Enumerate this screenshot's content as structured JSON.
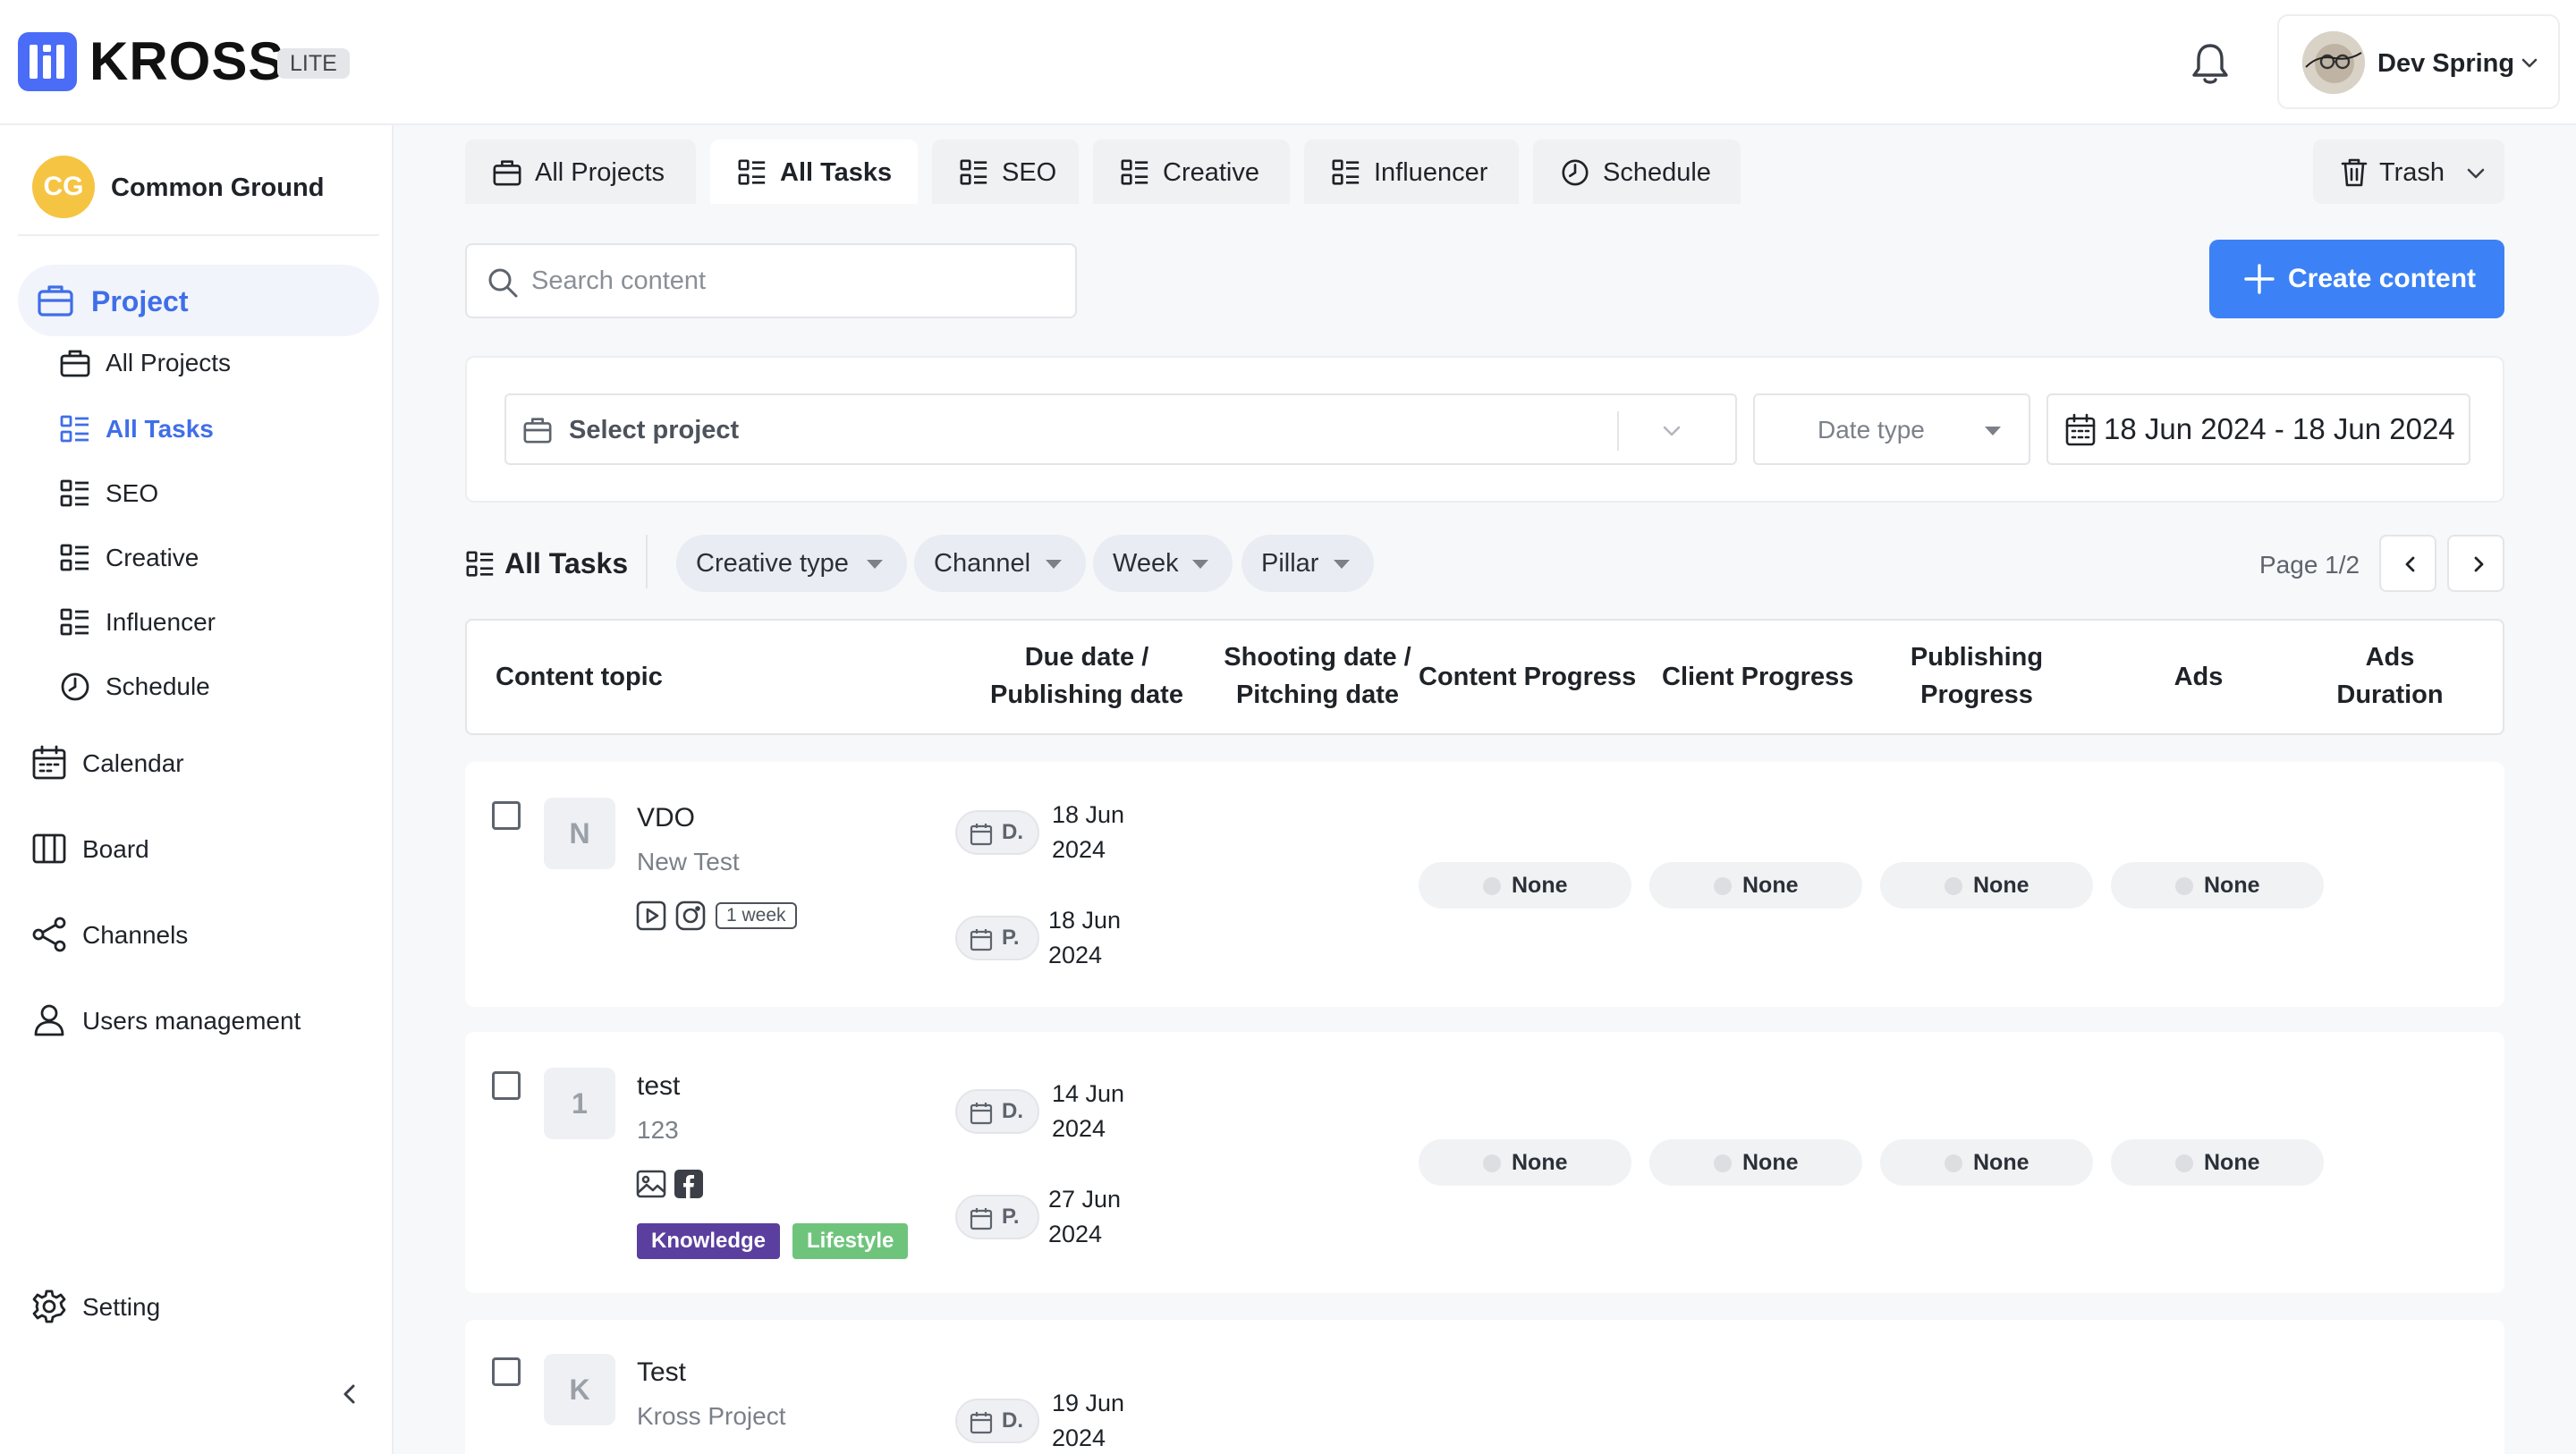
{
  "app": {
    "logo_text": "KROSS",
    "logo_badge": "LITE"
  },
  "header": {
    "user_name": "Dev Spring"
  },
  "sidebar": {
    "workspace_initials": "CG",
    "workspace_name": "Common Ground",
    "project_label": "Project",
    "project_items": [
      {
        "label": "All Projects",
        "icon": "briefcase-icon"
      },
      {
        "label": "All Tasks",
        "icon": "task-list-icon",
        "active": true
      },
      {
        "label": "SEO",
        "icon": "task-list-icon"
      },
      {
        "label": "Creative",
        "icon": "task-list-icon"
      },
      {
        "label": "Influencer",
        "icon": "task-list-icon"
      },
      {
        "label": "Schedule",
        "icon": "clock-icon"
      }
    ],
    "nav_items": [
      {
        "label": "Calendar",
        "icon": "calendar-icon"
      },
      {
        "label": "Board",
        "icon": "board-icon"
      },
      {
        "label": "Channels",
        "icon": "share-icon"
      },
      {
        "label": "Users management",
        "icon": "user-icon"
      }
    ],
    "setting_label": "Setting"
  },
  "tabs": [
    {
      "label": "All Projects",
      "icon": "briefcase-icon"
    },
    {
      "label": "All Tasks",
      "icon": "task-list-icon",
      "active": true
    },
    {
      "label": "SEO",
      "icon": "task-list-icon"
    },
    {
      "label": "Creative",
      "icon": "task-list-icon"
    },
    {
      "label": "Influencer",
      "icon": "task-list-icon"
    },
    {
      "label": "Schedule",
      "icon": "clock-icon"
    }
  ],
  "trash_label": "Trash",
  "search": {
    "placeholder": "Search content",
    "value": ""
  },
  "create_label": "Create content",
  "filters": {
    "select_project_placeholder": "Select project",
    "date_type_placeholder": "Date type",
    "date_range": "18 Jun 2024 - 18 Jun 2024"
  },
  "toolbar": {
    "title": "All Tasks",
    "pills": [
      "Creative type",
      "Channel",
      "Week",
      "Pillar"
    ],
    "page_label": "Page 1/2"
  },
  "table": {
    "headers": {
      "content_topic": "Content topic",
      "due_date": [
        "Due date /",
        "Publishing date"
      ],
      "shooting_date": [
        "Shooting date /",
        "Pitching date"
      ],
      "content_progress": "Content Progress",
      "client_progress": "Client Progress",
      "publishing_progress": [
        "Publishing",
        "Progress"
      ],
      "ads": "Ads",
      "ads_duration": [
        "Ads",
        "Duration"
      ]
    },
    "rows": [
      {
        "initial": "N",
        "topic": "VDO",
        "project": "New Test",
        "channels": [
          "video-icon",
          "instagram-icon"
        ],
        "week": "1 week",
        "tags": [],
        "due": {
          "letter": "D.",
          "line1": "18 Jun",
          "line2": "2024"
        },
        "publish": {
          "letter": "P.",
          "line1": "18 Jun",
          "line2": "2024"
        },
        "statuses": [
          "None",
          "None",
          "None",
          "None"
        ]
      },
      {
        "initial": "1",
        "topic": "test",
        "project": "123",
        "channels": [
          "image-icon",
          "facebook-icon"
        ],
        "week": "",
        "tags": [
          {
            "label": "Knowledge",
            "color": "#5b3f9e"
          },
          {
            "label": "Lifestyle",
            "color": "#6fc47c"
          }
        ],
        "due": {
          "letter": "D.",
          "line1": "14 Jun",
          "line2": "2024"
        },
        "publish": {
          "letter": "P.",
          "line1": "27 Jun",
          "line2": "2024"
        },
        "statuses": [
          "None",
          "None",
          "None",
          "None"
        ]
      },
      {
        "initial": "K",
        "topic": "Test",
        "project": "Kross Project",
        "due": {
          "letter": "D.",
          "line1": "19 Jun",
          "line2": "2024"
        }
      }
    ]
  },
  "colors": {
    "accent": "#3f6ee8",
    "create_button": "#3c82f6",
    "logo": "#4a6cf7",
    "workspace": "#f6c443"
  }
}
